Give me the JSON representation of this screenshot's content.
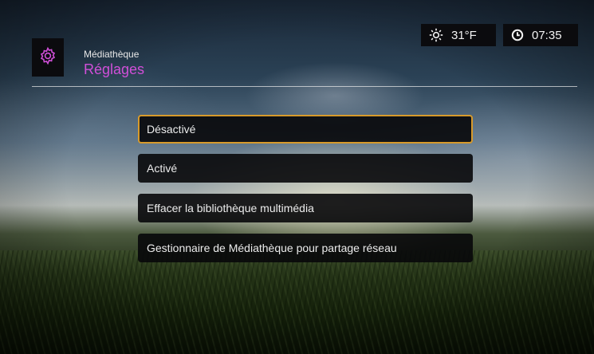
{
  "header": {
    "parent": "Médiathèque",
    "title": "Réglages",
    "icon": "gear-icon",
    "title_color": "#d04fd8"
  },
  "status": {
    "weather": {
      "icon": "sun-icon",
      "temperature": "31°F"
    },
    "clock": {
      "icon": "clock-icon",
      "time": "07:35"
    }
  },
  "menu": {
    "selected_index": 0,
    "highlight_color": "#d79a2b",
    "items": [
      {
        "label": "Désactivé"
      },
      {
        "label": "Activé"
      },
      {
        "label": "Effacer la bibliothèque multimédia"
      },
      {
        "label": "Gestionnaire de Médiathèque pour partage réseau"
      }
    ]
  }
}
